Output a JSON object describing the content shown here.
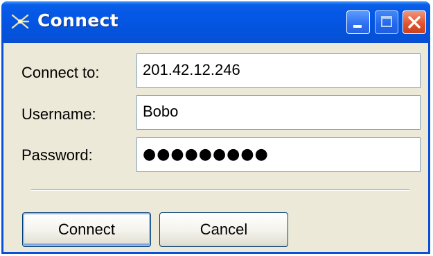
{
  "window": {
    "title": "Connect",
    "icon": "connect-antenna-icon",
    "controls": {
      "minimize": "minimize-icon",
      "maximize": "maximize-icon",
      "close": "close-icon"
    },
    "colors": {
      "titlebar": "#0558e6",
      "frame": "#0a4fd6",
      "client": "#ece9d8",
      "close_button": "#e2552f"
    }
  },
  "form": {
    "connect_to": {
      "label": "Connect to:",
      "value": "201.42.12.246"
    },
    "username": {
      "label": "Username:",
      "value": "Bobo"
    },
    "password": {
      "label": "Password:",
      "masked_value": "●●●●●●●●●"
    }
  },
  "buttons": {
    "connect": "Connect",
    "cancel": "Cancel"
  }
}
